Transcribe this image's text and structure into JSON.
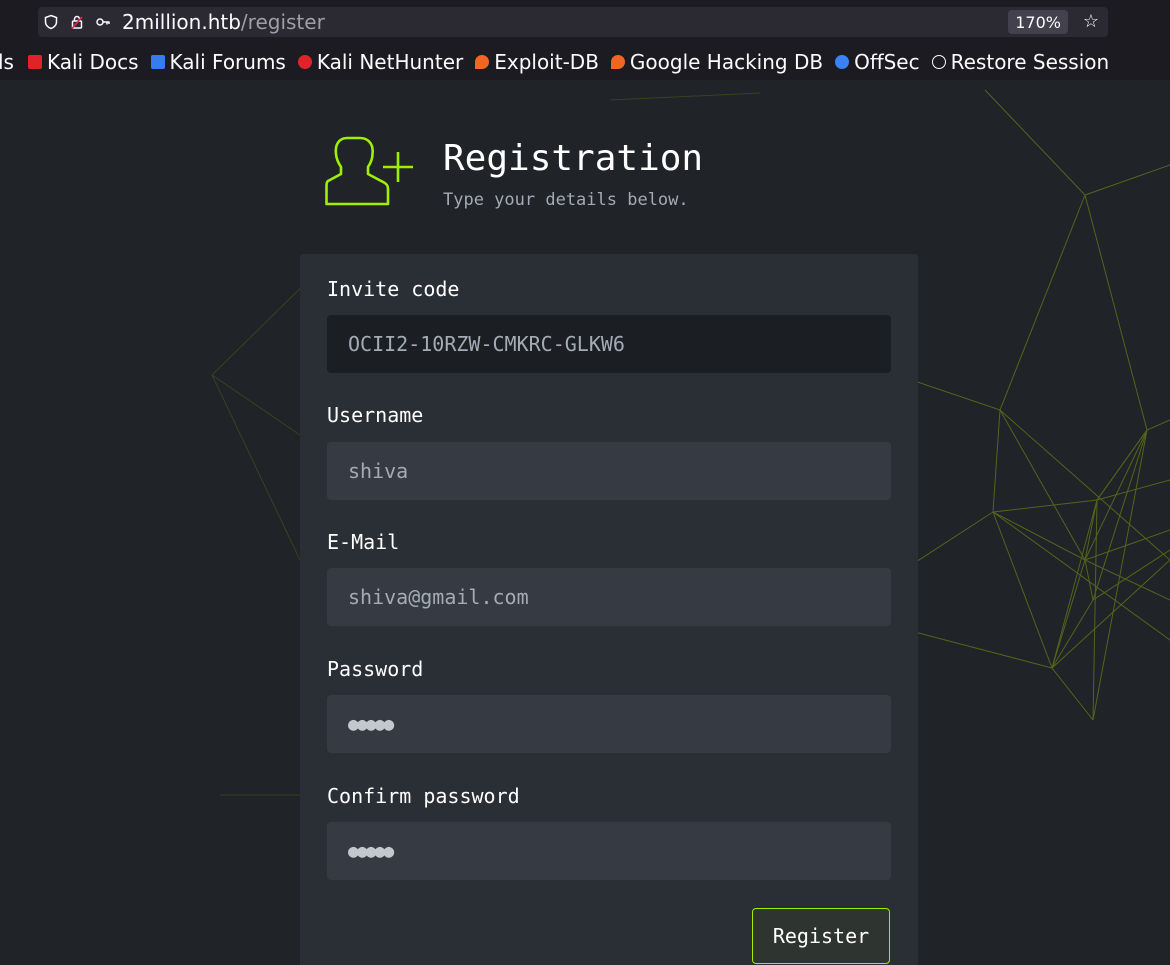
{
  "browser": {
    "url_host": "2million.htb",
    "url_path": "/register",
    "zoom": "170%",
    "icons": [
      "shield-icon",
      "lock-icon",
      "key-icon",
      "star-icon"
    ]
  },
  "bookmarks": {
    "truncated_first": "ls",
    "items": [
      {
        "label": "Kali Docs",
        "icon": "kali-docs-icon",
        "color": "#e0232b"
      },
      {
        "label": "Kali Forums",
        "icon": "kali-forums-icon",
        "color": "#367bf0"
      },
      {
        "label": "Kali NetHunter",
        "icon": "kali-nethunter-icon",
        "color": "#e0232b"
      },
      {
        "label": "Exploit-DB",
        "icon": "exploit-db-icon",
        "color": "#f26522"
      },
      {
        "label": "Google Hacking DB",
        "icon": "ghdb-icon",
        "color": "#f26522"
      },
      {
        "label": "OffSec",
        "icon": "offsec-icon",
        "color": "#3b82f6"
      },
      {
        "label": "Restore Session",
        "icon": "globe-icon",
        "color": "#fbfbfe"
      }
    ]
  },
  "header": {
    "title": "Registration",
    "subtitle": "Type your details below."
  },
  "form": {
    "invite_code": {
      "label": "Invite code",
      "value": "OCII2-10RZW-CMKRC-GLKW6"
    },
    "username": {
      "label": "Username",
      "value": "shiva"
    },
    "email": {
      "label": "E-Mail",
      "value": "shiva@gmail.com"
    },
    "password": {
      "label": "Password",
      "value": "●●●●●"
    },
    "confirm_password": {
      "label": "Confirm password",
      "value": "●●●●●"
    },
    "submit_label": "Register"
  },
  "colors": {
    "accent": "#9fef00",
    "page_bg": "#202328",
    "card_bg": "#2a2e35"
  }
}
